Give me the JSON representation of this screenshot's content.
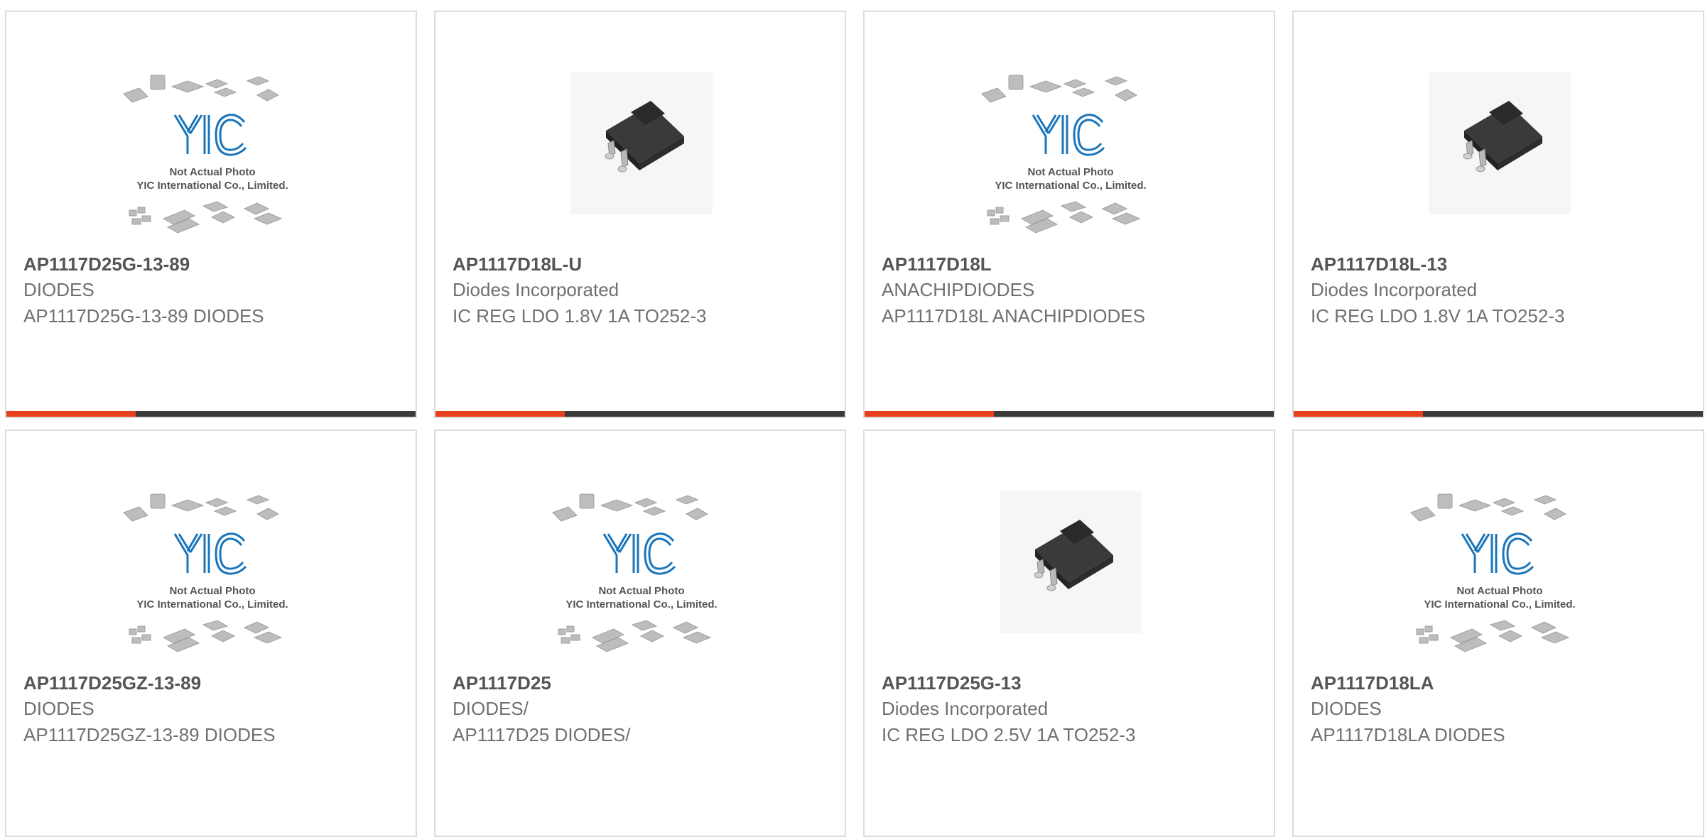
{
  "colors": {
    "accent": "#e8401c",
    "bar": "#3a3a3a",
    "card_border": "#dcdcdc",
    "logo_blue": "#1b75bb",
    "chip_dark": "#3a3a3a"
  },
  "placeholder": {
    "logo_text": "YIC",
    "line1": "Not Actual Photo",
    "line2": "YIC International Co., Limited."
  },
  "products": [
    {
      "part": "AP1117D25G-13-89",
      "manufacturer": "DIODES",
      "description": "AP1117D25G-13-89 DIODES",
      "image": "placeholder"
    },
    {
      "part": "AP1117D18L-U",
      "manufacturer": "Diodes Incorporated",
      "description": "IC REG LDO 1.8V 1A TO252-3",
      "image": "to252-chip-icon"
    },
    {
      "part": "AP1117D18L",
      "manufacturer": "ANACHIPDIODES",
      "description": "AP1117D18L ANACHIPDIODES",
      "image": "placeholder"
    },
    {
      "part": "AP1117D18L-13",
      "manufacturer": "Diodes Incorporated",
      "description": "IC REG LDO 1.8V 1A TO252-3",
      "image": "to252-chip-icon"
    },
    {
      "part": "AP1117D25GZ-13-89",
      "manufacturer": "DIODES",
      "description": "AP1117D25GZ-13-89 DIODES",
      "image": "placeholder"
    },
    {
      "part": "AP1117D25",
      "manufacturer": "DIODES/",
      "description": "AP1117D25 DIODES/",
      "image": "placeholder"
    },
    {
      "part": "AP1117D25G-13",
      "manufacturer": "Diodes Incorporated",
      "description": "IC REG LDO 2.5V 1A TO252-3",
      "image": "to252-chip-icon"
    },
    {
      "part": "AP1117D18LA",
      "manufacturer": "DIODES",
      "description": "AP1117D18LA DIODES",
      "image": "placeholder"
    }
  ]
}
